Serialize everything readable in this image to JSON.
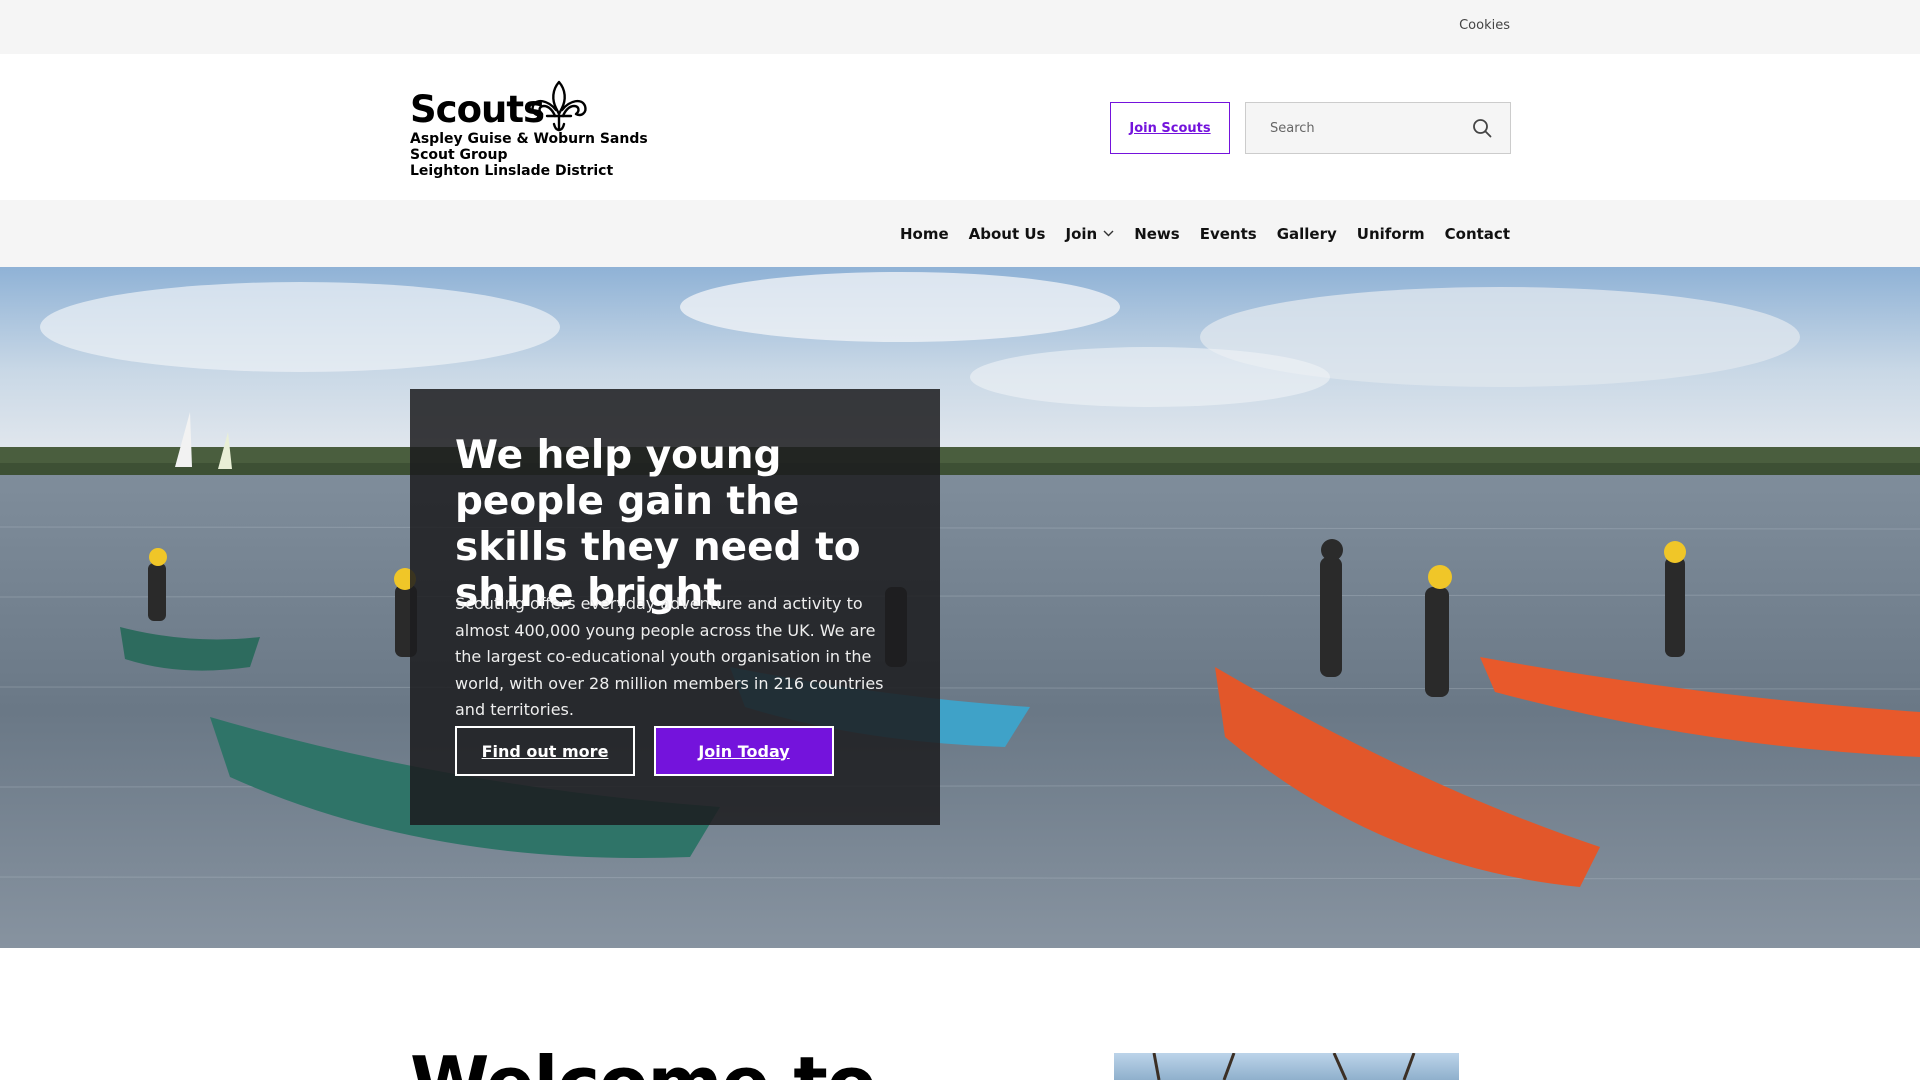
{
  "topbar": {
    "cookies_label": "Cookies"
  },
  "logo": {
    "wordmark": "Scouts",
    "group_line1": "Aspley Guise & Woburn Sands",
    "group_line2": "Scout Group",
    "district": "Leighton Linslade District"
  },
  "header": {
    "join_button": "Join Scouts",
    "search_placeholder": "Search"
  },
  "nav": {
    "items": [
      {
        "label": "Home"
      },
      {
        "label": "About Us"
      },
      {
        "label": "Join"
      },
      {
        "label": "News"
      },
      {
        "label": "Events"
      },
      {
        "label": "Gallery"
      },
      {
        "label": "Uniform"
      },
      {
        "label": "Contact"
      }
    ]
  },
  "hero": {
    "title": "We help young people gain the skills they need to shine bright",
    "body": "Scouting offers everyday adventure and activity to almost 400,000 young people across the UK. We are the largest co-educational youth organisation in the world, with over 28 million members in 216 countries and territories.",
    "find_out_more": "Find out more",
    "join_today": "Join Today"
  },
  "welcome": {
    "heading": "Welcome to"
  },
  "colors": {
    "brand_purple": "#7413dc",
    "panel": "#1c1c1e",
    "bar_grey": "#f5f5f5"
  },
  "icons": {
    "search": "search-icon",
    "dropdown": "chevron-down-icon",
    "logo": "fleur-de-lis-icon"
  }
}
